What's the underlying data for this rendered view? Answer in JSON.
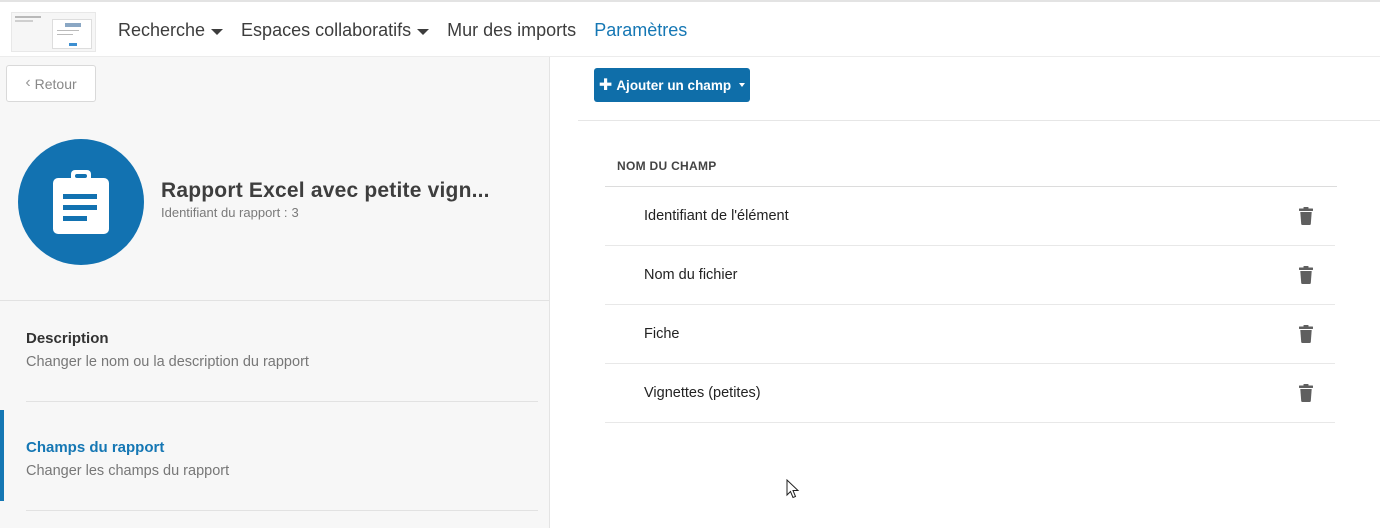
{
  "nav": {
    "items": [
      {
        "label": "Recherche",
        "has_caret": true,
        "active": false
      },
      {
        "label": "Espaces collaboratifs",
        "has_caret": true,
        "active": false
      },
      {
        "label": "Mur des imports",
        "has_caret": false,
        "active": false
      },
      {
        "label": "Paramètres",
        "has_caret": false,
        "active": true
      }
    ]
  },
  "sidebar": {
    "back_label": "Retour",
    "report_icon": "clipboard-icon",
    "report_title": "Rapport Excel avec petite vign...",
    "report_id_label": "Identifiant du rapport :",
    "report_id_value": "3",
    "menu": [
      {
        "title": "Description",
        "desc": "Changer le nom ou la description du rapport",
        "active": false
      },
      {
        "title": "Champs du rapport",
        "desc": "Changer les champs du rapport",
        "active": true
      }
    ]
  },
  "main": {
    "add_field_label": "Ajouter un champ",
    "column_header": "NOM DU CHAMP",
    "fields": [
      "Identifiant de l'élément",
      "Nom du fichier",
      "Fiche",
      "Vignettes (petites)"
    ]
  },
  "colors": {
    "accent": "#1577b4",
    "button_blue": "#0f6ea9",
    "avatar_blue": "#1272b1"
  }
}
